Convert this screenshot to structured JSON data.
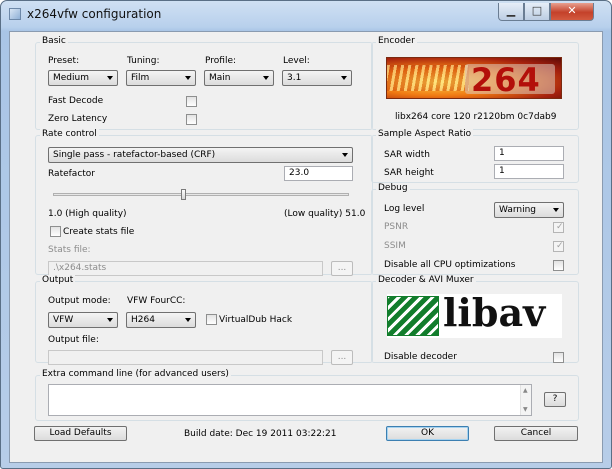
{
  "window": {
    "title": "x264vfw configuration"
  },
  "basic": {
    "title": "Basic",
    "preset_label": "Preset:",
    "preset_value": "Medium",
    "tuning_label": "Tuning:",
    "tuning_value": "Film",
    "profile_label": "Profile:",
    "profile_value": "Main",
    "level_label": "Level:",
    "level_value": "3.1",
    "fast_decode_label": "Fast Decode",
    "zero_latency_label": "Zero Latency"
  },
  "encoder": {
    "title": "Encoder",
    "logo_text": "264",
    "version": "libx264 core 120 r2120bm 0c7dab9"
  },
  "rate_control": {
    "title": "Rate control",
    "mode_value": "Single pass - ratefactor-based (CRF)",
    "ratefactor_label": "Ratefactor",
    "ratefactor_value": "23.0",
    "slider_fraction": 0.44,
    "min_label": "1.0 (High quality)",
    "max_label": "(Low quality) 51.0",
    "create_stats_label": "Create stats file",
    "stats_file_label": "Stats file:",
    "stats_file_value": ".\\x264.stats",
    "browse_label": "..."
  },
  "sar": {
    "title": "Sample Aspect Ratio",
    "width_label": "SAR width",
    "width_value": "1",
    "height_label": "SAR height",
    "height_value": "1"
  },
  "debug": {
    "title": "Debug",
    "log_level_label": "Log level",
    "log_level_value": "Warning",
    "psnr_label": "PSNR",
    "ssim_label": "SSIM",
    "disable_cpu_label": "Disable all CPU optimizations"
  },
  "output": {
    "title": "Output",
    "mode_label": "Output mode:",
    "mode_value": "VFW",
    "fourcc_label": "VFW FourCC:",
    "fourcc_value": "H264",
    "vdub_label": "VirtualDub Hack",
    "file_label": "Output file:",
    "browse_label": "..."
  },
  "decoder": {
    "title": "Decoder & AVI Muxer",
    "logo_text": "libav",
    "disable_label": "Disable decoder"
  },
  "extra": {
    "title": "Extra command line (for advanced users)",
    "help_label": "?"
  },
  "footer": {
    "load_defaults": "Load Defaults",
    "build_date": "Build date: Dec 19 2011 03:22:21",
    "ok": "OK",
    "cancel": "Cancel"
  }
}
